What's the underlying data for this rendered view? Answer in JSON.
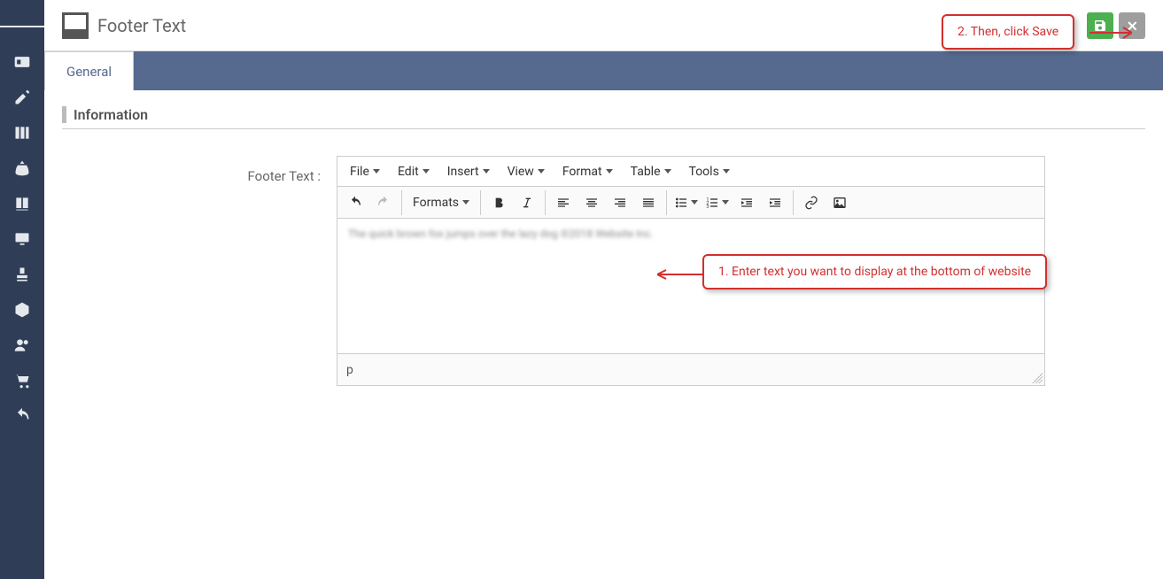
{
  "page": {
    "title": "Footer Text",
    "section": "Information",
    "form_label": "Footer Text :"
  },
  "tabs": {
    "general": "General"
  },
  "editor": {
    "menu": {
      "file": "File",
      "edit": "Edit",
      "insert": "Insert",
      "view": "View",
      "format": "Format",
      "table": "Table",
      "tools": "Tools"
    },
    "formats_label": "Formats",
    "status_path": "p",
    "body_text": "The quick brown fox jumps over the lazy dog ©2018 Website Inc."
  },
  "callouts": {
    "step1": "1.  Enter text you want to display at the bottom of website",
    "step2": "2. Then, click Save"
  },
  "colors": {
    "sidebar": "#2f3e56",
    "tabbar": "#56698f",
    "save": "#4caf50",
    "cancel": "#9e9e9e",
    "callout": "#d32f2f"
  }
}
